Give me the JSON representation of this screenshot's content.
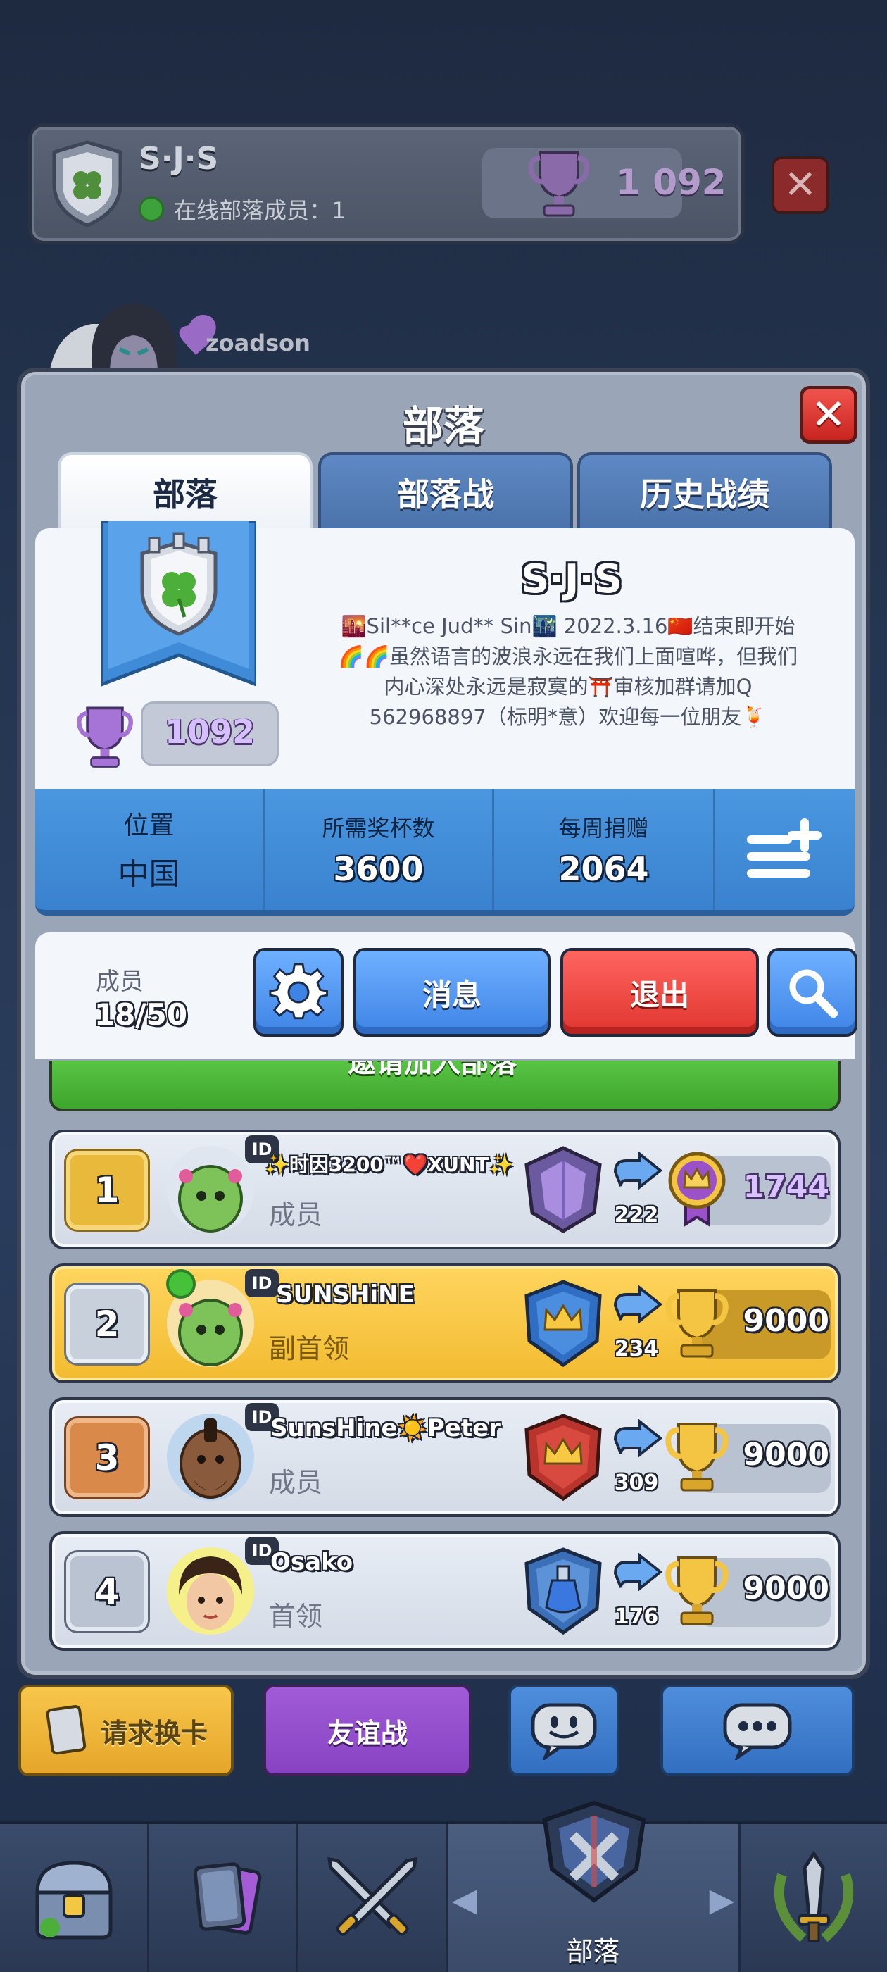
{
  "bg_header": {
    "clan_name": "S·J·S",
    "online_text": "在线部落成员：1",
    "trophies": "1 092",
    "player_name": "zoadson"
  },
  "panel": {
    "title": "部落",
    "tabs": [
      {
        "label": "部落",
        "active": true
      },
      {
        "label": "部落战",
        "active": false
      },
      {
        "label": "历史战绩",
        "active": false
      }
    ]
  },
  "clan": {
    "name": "S·J·S",
    "trophies": "1092",
    "description_lines": [
      "🌇Sil**ce Jud** Sin🌃 2022.3.16🇨🇳结束即开始",
      "🌈🌈虽然语言的波浪永远在我们上面喧哗，但我们",
      "内心深处永远是寂寞的⛩️审核加群请加Q",
      "562968897（标明*意）欢迎每一位朋友🍹"
    ]
  },
  "stats": {
    "location_label": "位置",
    "location_value": "中国",
    "required_label": "所需奖杯数",
    "required_value": "3600",
    "weekly_label": "每周捐赠",
    "weekly_value": "2064"
  },
  "members_bar": {
    "label": "成员",
    "count": "18/50",
    "message_button": "消息",
    "leave_button": "退出"
  },
  "invite_strip_text": "邀请加入部落",
  "members": [
    {
      "rank": "1",
      "name": "✨时因3200™❤️XUNT✨",
      "role": "成员",
      "donations": "222",
      "score": "1744",
      "online": false
    },
    {
      "rank": "2",
      "name": "SUNSHiNE",
      "role": "副首领",
      "donations": "234",
      "score": "9000",
      "online": true
    },
    {
      "rank": "3",
      "name": "SunsHine☀️Peter",
      "role": "成员",
      "donations": "309",
      "score": "9000",
      "online": false
    },
    {
      "rank": "4",
      "name": "Osako",
      "role": "首领",
      "donations": "176",
      "score": "9000",
      "online": false
    }
  ],
  "actions": {
    "request_cards": "请求换卡",
    "friendly_battle": "友谊战"
  },
  "nav": {
    "active_label": "部落"
  },
  "colors": {
    "accent_blue": "#3e84e6",
    "leave_red": "#e0352f",
    "highlight_gold": "#f2bb30",
    "online_green": "#45c23a"
  }
}
